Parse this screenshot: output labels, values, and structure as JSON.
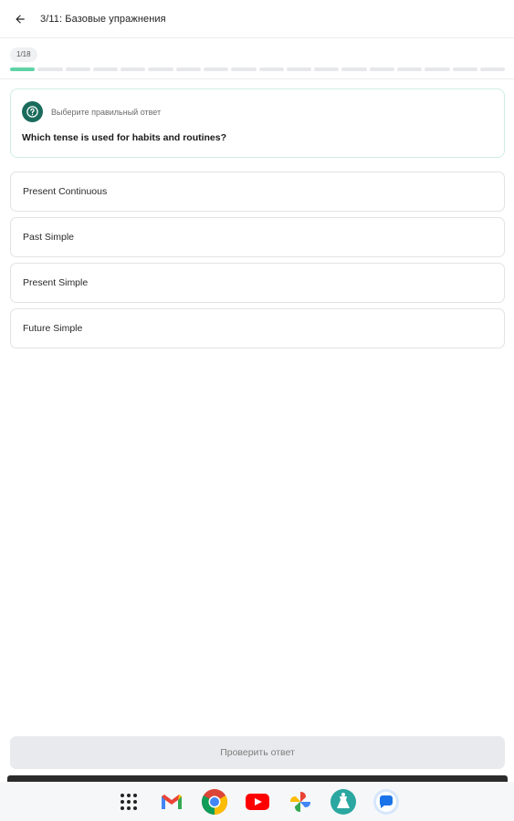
{
  "header": {
    "title": "3/11: Базовые упражнения",
    "back_icon": "arrow-left-icon"
  },
  "progress": {
    "step_label": "1/18",
    "current": 1,
    "total": 18,
    "active_color": "#5dd3a6"
  },
  "question": {
    "instruction": "Выберите правильный ответ",
    "text": "Which tense is used for habits and routines?",
    "icon": "question-circle-icon"
  },
  "options": [
    {
      "label": "Present Continuous"
    },
    {
      "label": "Past Simple"
    },
    {
      "label": "Present Simple"
    },
    {
      "label": "Future Simple"
    }
  ],
  "actions": {
    "check_label": "Проверить ответ"
  },
  "dock": {
    "apps": [
      "app-grid-icon",
      "gmail-icon",
      "chrome-icon",
      "youtube-icon",
      "photos-icon",
      "app-teal-icon",
      "messages-icon"
    ]
  }
}
